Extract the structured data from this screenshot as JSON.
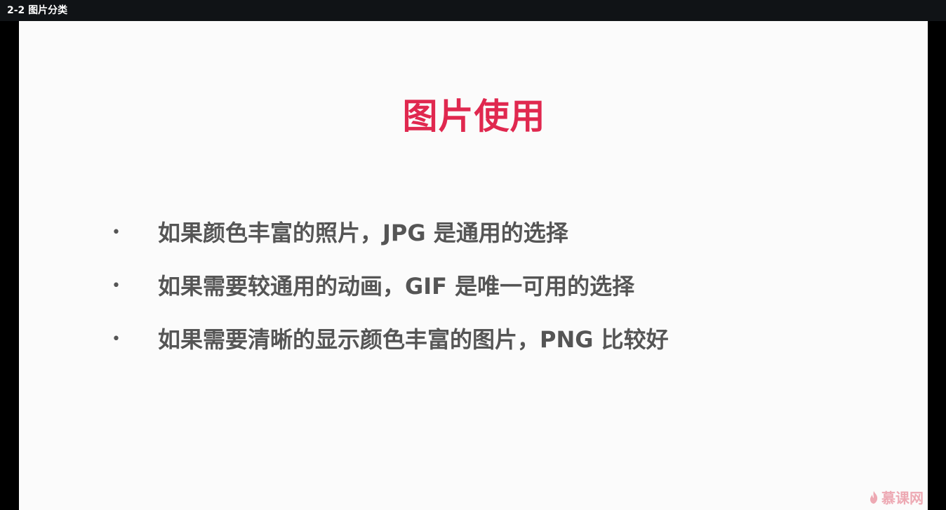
{
  "window": {
    "title": "2-2 图片分类"
  },
  "slide": {
    "title": "图片使用",
    "bullet_glyph": "•",
    "bullets": [
      "如果颜色丰富的照片，JPG 是通用的选择",
      "如果需要较通用的动画，GIF 是唯一可用的选择",
      "如果需要清晰的显示颜色丰富的图片，PNG 比较好"
    ],
    "title_color": "#e0284f"
  },
  "watermark": {
    "text": "慕课网",
    "icon": "flame-logo-icon"
  }
}
